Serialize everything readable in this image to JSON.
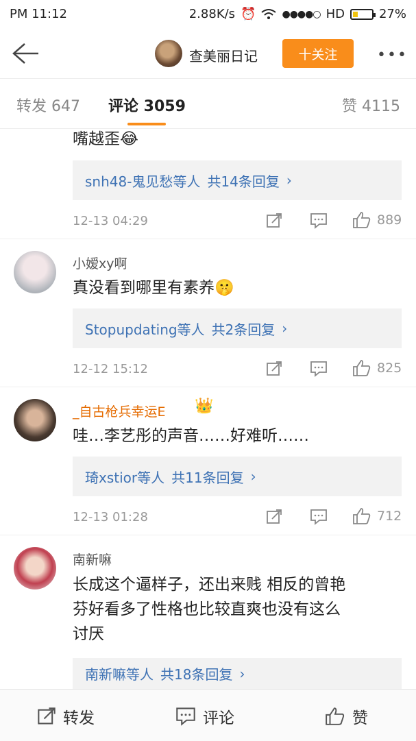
{
  "status_bar": {
    "left": "PM  11:12",
    "speed": "2.88K/s",
    "hd": "HD",
    "battery": "27%",
    "battery_level": 0.27
  },
  "header": {
    "account_name": "查美丽日记",
    "follow_label": "十关注",
    "more": "•••"
  },
  "tabs": {
    "repost": "转发 647",
    "comment": "评论 3059",
    "like": "赞 4115"
  },
  "comments": [
    {
      "text": "嘴越歪😂",
      "reply_users": "snh48-鬼见愁等人",
      "reply_count": "共14条回复",
      "time": "12-13 04:29",
      "likes": "889"
    },
    {
      "username": "小嫒xy啊",
      "text": "真没看到哪里有素养🤫",
      "reply_users": "Stopupdating等人",
      "reply_count": "共2条回复",
      "time": "12-12 15:12",
      "likes": "825"
    },
    {
      "username": "_自古枪兵幸运E",
      "text": "哇…李艺彤的声音……好难听……",
      "reply_users": "琦xstior等人",
      "reply_count": "共11条回复",
      "time": "12-13 01:28",
      "likes": "712"
    },
    {
      "username": "南新嘛",
      "text_line1": "长成这个逼样子，还出来贱 相反的曾艳",
      "text_line2": "芬好看多了性格也比较直爽也没有这么",
      "text_line3": "讨厌",
      "reply_users": "南新嘛等人",
      "reply_count": "共18条回复"
    }
  ],
  "bottom_bar": {
    "repost": "转发",
    "comment": "评论",
    "like": "赞"
  },
  "colors": {
    "accent": "#f98d1b",
    "link": "#3e72b4",
    "vip": "#e56b00"
  }
}
